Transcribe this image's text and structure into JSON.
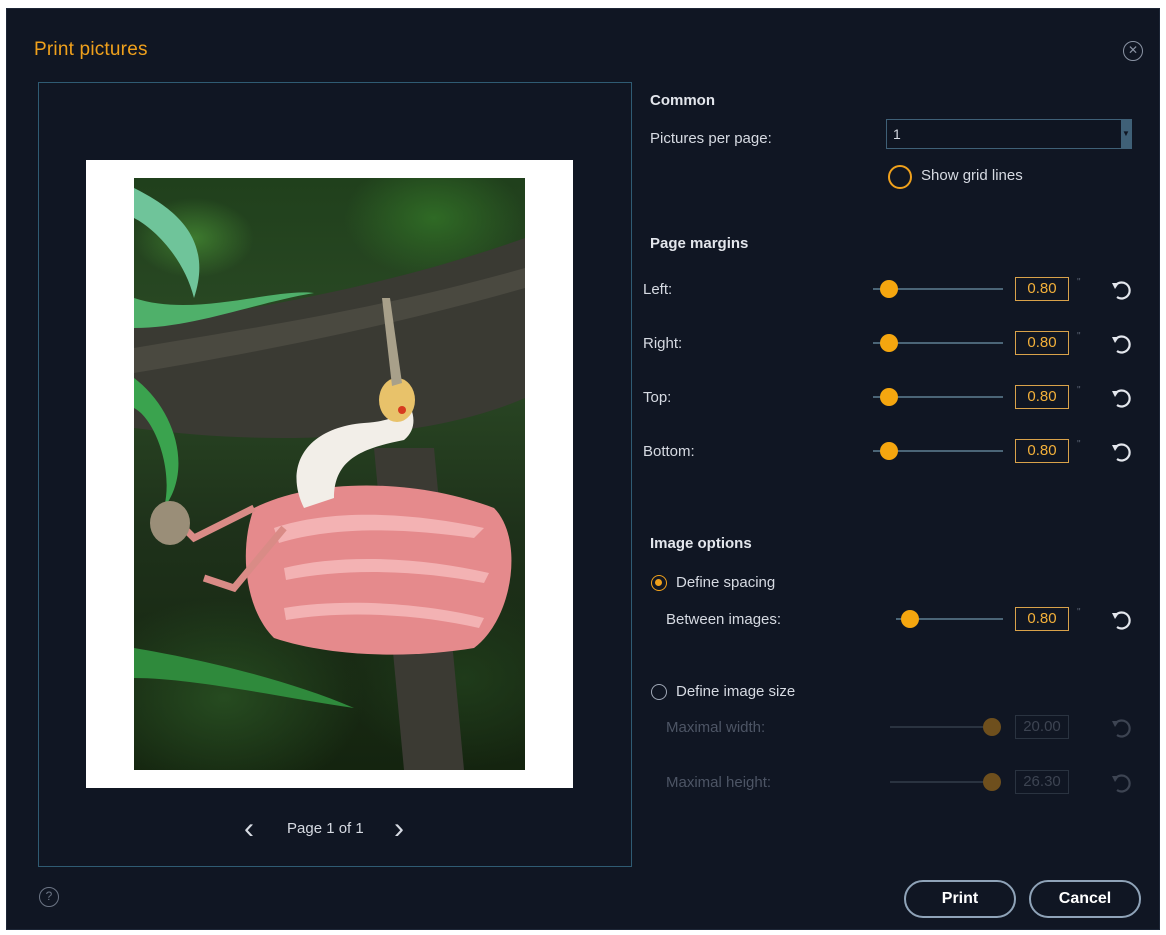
{
  "dialog": {
    "title": "Print pictures",
    "close_icon": "close-circle-icon",
    "help_icon": "help-icon"
  },
  "preview": {
    "page_label": "Page 1 of 1",
    "prev_icon": "chevron-left-icon",
    "next_icon": "chevron-right-icon"
  },
  "common": {
    "heading": "Common",
    "pictures_per_page_label": "Pictures per page:",
    "pictures_per_page_value": "1",
    "show_grid_lines_label": "Show grid lines",
    "show_grid_lines_checked": false
  },
  "margins": {
    "heading": "Page margins",
    "unit": "\"",
    "items": [
      {
        "label": "Left:",
        "value": "0.80",
        "level": 0.06
      },
      {
        "label": "Right:",
        "value": "0.80",
        "level": 0.06
      },
      {
        "label": "Top:",
        "value": "0.80",
        "level": 0.06
      },
      {
        "label": "Bottom:",
        "value": "0.80",
        "level": 0.06
      }
    ]
  },
  "image_options": {
    "heading": "Image options",
    "define_spacing_label": "Define spacing",
    "define_spacing_selected": true,
    "between_images_label": "Between images:",
    "between_images_value": "0.80",
    "between_images_level": 0.06,
    "define_size_label": "Define image size",
    "define_size_selected": false,
    "max_width_label": "Maximal width:",
    "max_width_value": "20.00",
    "max_width_level": 1.0,
    "max_height_label": "Maximal height:",
    "max_height_value": "26.30",
    "max_height_level": 1.0
  },
  "buttons": {
    "print": "Print",
    "cancel": "Cancel"
  },
  "colors": {
    "accent": "#f0a11c",
    "background": "#101623"
  }
}
